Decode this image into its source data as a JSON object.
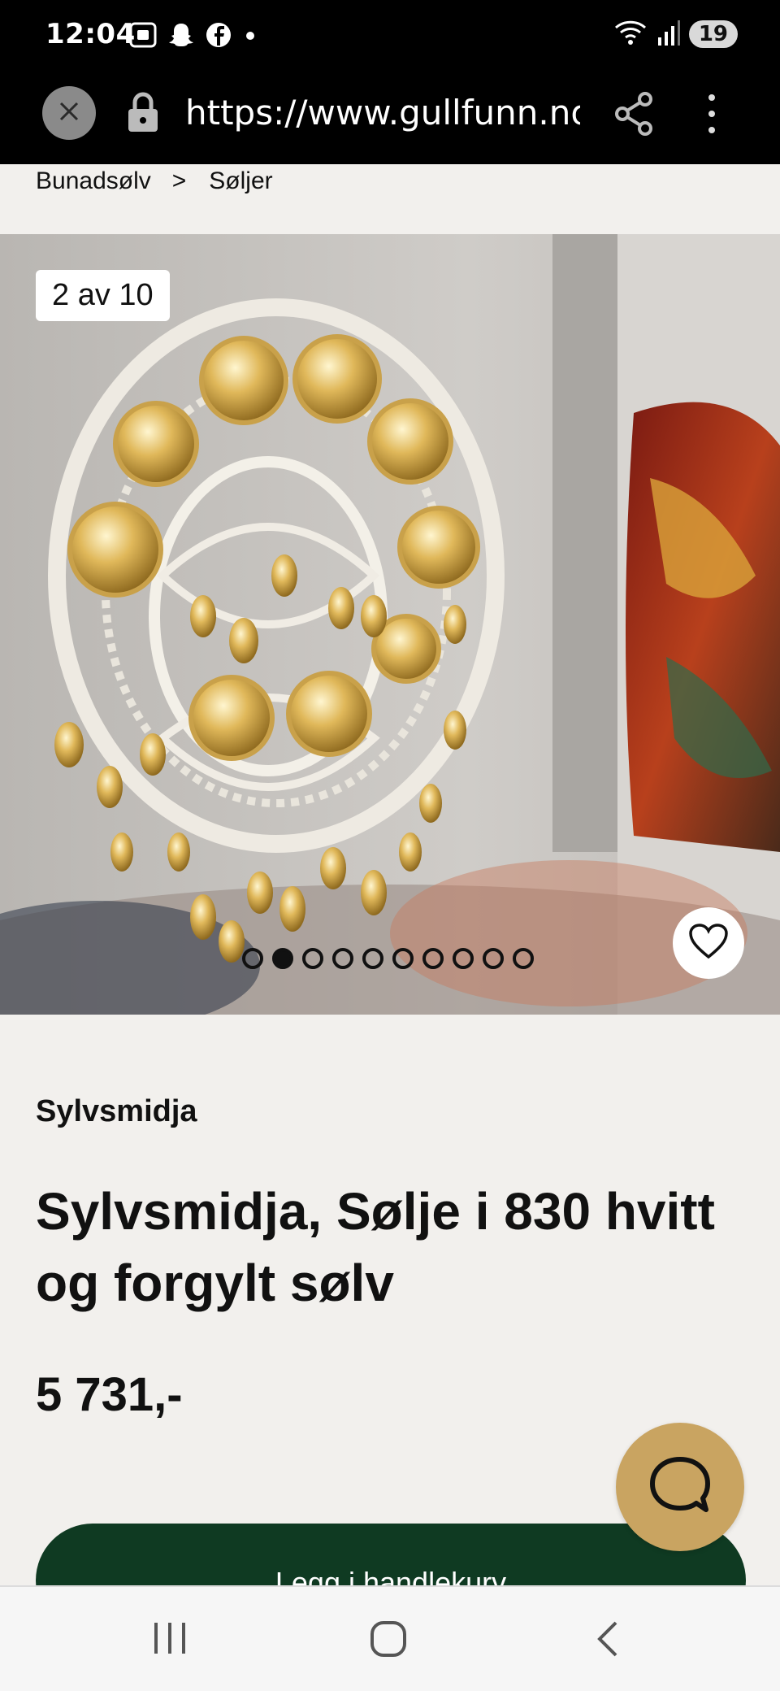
{
  "status_bar": {
    "time": "12:04",
    "battery": "19",
    "left_icons": [
      "screenshot-icon",
      "snapchat-icon",
      "facebook-icon",
      "dot-icon"
    ],
    "right_icons": [
      "wifi-icon",
      "signal-icon"
    ]
  },
  "browser": {
    "url": "https://www.gullfunn.no/p"
  },
  "breadcrumb": {
    "items": [
      "Bunadsølv",
      "Søljer"
    ],
    "separator": ">"
  },
  "gallery": {
    "counter": "2 av 10",
    "total": 10,
    "active_index": 1
  },
  "product": {
    "brand": "Sylvsmidja",
    "title": "Sylvsmidja, Sølje i 830 hvitt og forgylt sølv",
    "price": "5 731,-",
    "add_to_cart_label": "Legg i handlekurv"
  },
  "colors": {
    "cart_button": "#0f3a22",
    "chat_button": "#c9a461",
    "background": "#f2f0ed"
  }
}
